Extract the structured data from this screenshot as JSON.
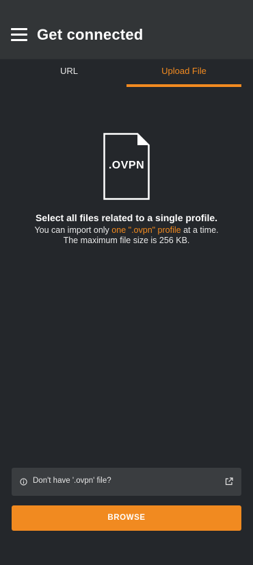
{
  "app_bar": {
    "title": "Get connected",
    "menu_icon": "hamburger-menu-icon"
  },
  "tabs": [
    {
      "label": "URL",
      "selected": false
    },
    {
      "label": "Upload File",
      "selected": true
    }
  ],
  "file_icon": {
    "icon": "file-document-icon",
    "extension_label": ".OVPN"
  },
  "instructions": {
    "title": "Select all files related to a single profile.",
    "line1_prefix": "You can import only ",
    "line1_highlight": "one \".ovpn\" profile",
    "line1_suffix": " at a time.",
    "line2": "The maximum file size is 256 KB."
  },
  "help_bar": {
    "text": "Don't have '.ovpn' file?",
    "info_icon": "info-icon",
    "link_icon": "external-link-icon"
  },
  "browse_button": {
    "label": "BROWSE"
  },
  "colors": {
    "background": "#24272b",
    "app_bar": "#323537",
    "accent": "#f18a20",
    "help_bar": "#3a3d40"
  }
}
